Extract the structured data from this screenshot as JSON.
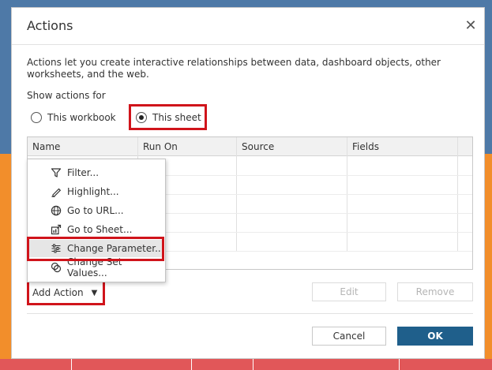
{
  "dialog": {
    "title": "Actions",
    "close_glyph": "✕",
    "description": "Actions let you create interactive relationships between data, dashboard objects, other worksheets, and the web.",
    "show_actions_label": "Show actions for",
    "scope_options": [
      {
        "label": "This workbook",
        "selected": false
      },
      {
        "label": "This sheet",
        "selected": true
      }
    ],
    "table": {
      "columns": [
        "Name",
        "Run On",
        "Source",
        "Fields"
      ],
      "rows": []
    },
    "add_action": {
      "label": "Add Action",
      "caret": "▼"
    },
    "menu": {
      "items": [
        {
          "label": "Filter...",
          "icon": "filter-icon"
        },
        {
          "label": "Highlight...",
          "icon": "highlight-icon"
        },
        {
          "label": "Go to URL...",
          "icon": "globe-icon"
        },
        {
          "label": "Go to Sheet...",
          "icon": "sheet-icon"
        },
        {
          "label": "Change Parameter...",
          "icon": "parameter-icon",
          "hovered": true
        },
        {
          "label": "Change Set Values...",
          "icon": "set-values-icon"
        }
      ]
    },
    "buttons": {
      "edit": "Edit",
      "remove": "Remove",
      "cancel": "Cancel",
      "ok": "OK"
    }
  },
  "colors": {
    "accent": "#1f5f8b",
    "highlight_box": "#d0141b",
    "bg_blue": "#4e79a7",
    "bg_orange": "#f28e2b",
    "bg_red": "#e15759"
  }
}
